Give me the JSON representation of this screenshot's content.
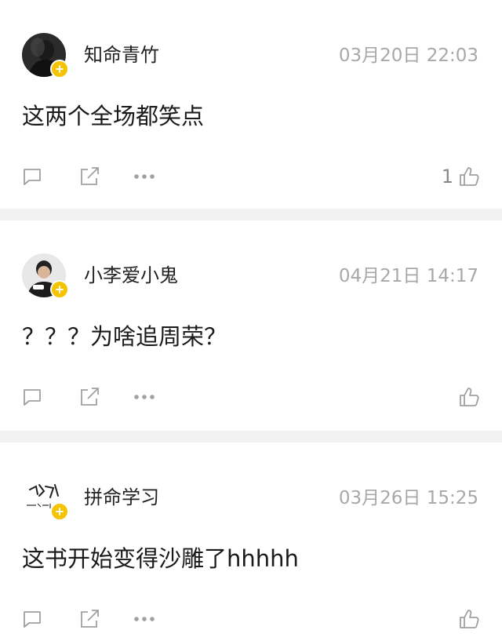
{
  "comments": [
    {
      "username": "知命青竹",
      "time": "03月20日 22:03",
      "text": "这两个全场都笑点",
      "like_count": "1",
      "icons": {
        "comment": "comment-icon",
        "share": "share-icon",
        "more": "more-icon",
        "like": "thumbs-up-icon"
      },
      "badge_color": "#f5c400"
    },
    {
      "username": "小李爱小鬼",
      "time": "04月21日 14:17",
      "text": "？？？为啥追周荣？",
      "like_count": "",
      "icons": {
        "comment": "comment-icon",
        "share": "share-icon",
        "more": "more-icon",
        "like": "thumbs-up-icon"
      },
      "badge_color": "#f5c400"
    },
    {
      "username": "拼命学习",
      "time": "03月26日 15:25",
      "text": "这书开始变得沙雕了hhhhh",
      "like_count": "",
      "icons": {
        "comment": "comment-icon",
        "share": "share-icon",
        "more": "more-icon",
        "like": "thumbs-up-icon"
      },
      "badge_color": "#f5c400"
    }
  ]
}
